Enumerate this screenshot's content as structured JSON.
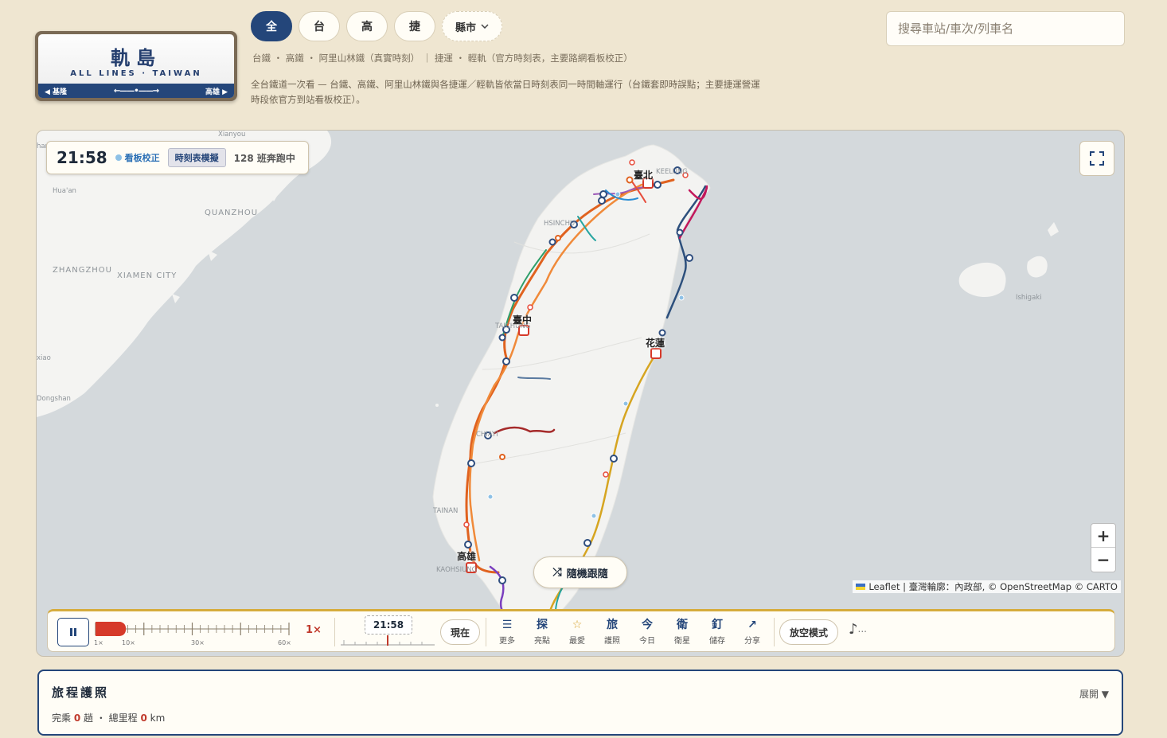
{
  "logo": {
    "title": "軌島",
    "subtitle": "ALL LINES · TAIWAN",
    "left_station": "◀ 基隆",
    "right_station": "高雄 ▶",
    "arrow": "←——•——→"
  },
  "filters": [
    {
      "label": "全",
      "active": true
    },
    {
      "label": "台",
      "active": false
    },
    {
      "label": "高",
      "active": false
    },
    {
      "label": "捷",
      "active": false
    }
  ],
  "county_filter": {
    "label": "縣市",
    "icon": "chevron-down-icon"
  },
  "subtitle": "台鐵 ・ 高鐵 ・ 阿里山林鐵（真實時刻） ｜ 捷運 ・ 輕軌（官方時刻表，主要路網看板校正）",
  "description": "全台鐵道一次看 — 台鐵、高鐵、阿里山林鐵與各捷運／輕軌皆依當日時刻表同一時間軸運行（台鐵套即時誤點；主要捷運營運時段依官方到站看板校正）。",
  "search": {
    "placeholder": "搜尋車站/車次/列車名",
    "value": ""
  },
  "map": {
    "places": {
      "xianyou": "Xianyou",
      "huaan": "Hua'an",
      "quanzhou": "QUANZHOU",
      "zhangzhou": "ZHANGZHOU",
      "xiamen": "XIAMEN CITY",
      "xiao": "xiao",
      "dongshan": "Dongshan",
      "ishigaki": "Ishigaki",
      "han": "han",
      "keelung": "KEELUNG",
      "hsinchu": "HSINCHU",
      "taichung": "TAICHUNG",
      "chiayi": "CHIAYI",
      "tainan": "TAINAN",
      "kaohsiung": "KAOHSIUNG"
    },
    "city_labels": {
      "taipei": "臺北",
      "taichung": "臺中",
      "hualien": "花蓮",
      "kaohsiung": "高雄"
    },
    "colors": {
      "tra": "#e0621f",
      "hsr": "#f08a3a",
      "east": "#d6a521",
      "alishan": "#a52a2a",
      "station": "#2f4e7f"
    }
  },
  "clock": {
    "time": "21:58",
    "calibration": "看板校正",
    "mode": "時刻表模擬",
    "running": "128 班奔跑中"
  },
  "random_follow": "隨機跟隨",
  "attribution": "Leaflet | 臺灣輪廓：內政部, © OpenStreetMap © CARTO",
  "zoom": {
    "in": "+",
    "out": "−"
  },
  "controls": {
    "speed_labels": [
      "1×",
      "10×",
      "30×",
      "60×"
    ],
    "speed_current": "1×",
    "speed_fraction": 0.0,
    "time": "21:58",
    "now": "現在",
    "tools": [
      {
        "icon": "☰",
        "label": "更多",
        "name": "more"
      },
      {
        "icon": "探",
        "label": "亮點",
        "name": "highlights"
      },
      {
        "icon": "☆",
        "label": "最愛",
        "name": "favorites"
      },
      {
        "icon": "旅",
        "label": "護照",
        "name": "passport"
      },
      {
        "icon": "今",
        "label": "今日",
        "name": "today"
      },
      {
        "icon": "衛",
        "label": "衛星",
        "name": "satellite"
      },
      {
        "icon": "釘",
        "label": "儲存",
        "name": "save"
      },
      {
        "icon": "↗",
        "label": "分享",
        "name": "share"
      }
    ],
    "noflight": "放空模式",
    "music": "♪",
    "music_more": "..."
  },
  "passport": {
    "title": "旅程護照",
    "expand": "展開 ▼",
    "stats_prefix": "完乘 ",
    "trips": "0",
    "stats_middle": " 趟 ・ 總里程 ",
    "distance": "0",
    "stats_suffix": " km"
  }
}
